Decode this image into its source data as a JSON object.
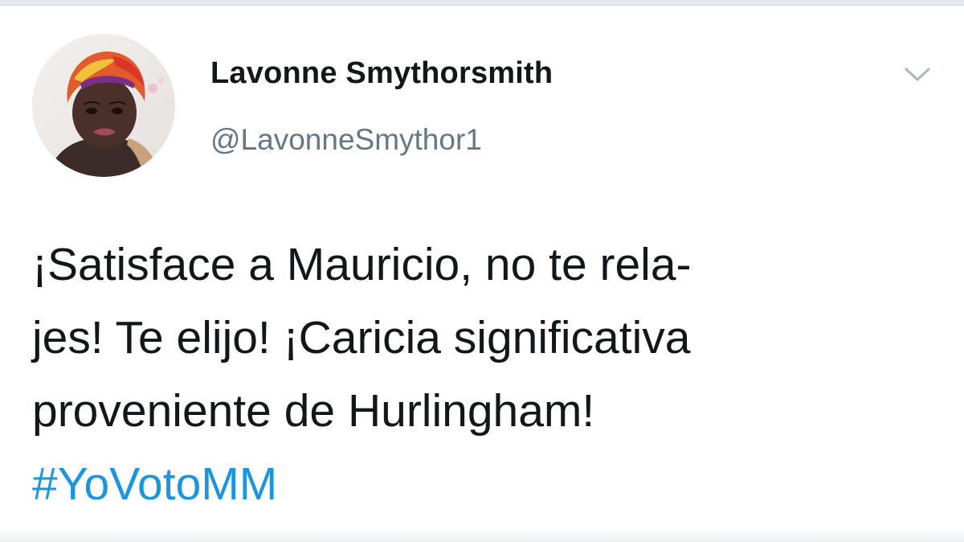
{
  "tweet": {
    "author": {
      "display_name": "Lavonne Smythorsmith",
      "handle": "@LavonneSmythor1"
    },
    "text_lines": [
      "¡Satisface a Mauricio, no te rela-",
      "jes! Te elijo! ¡Caricia significativa",
      "proveniente de Hurlingham!"
    ],
    "hashtag": "#YoVotoMM",
    "icons": {
      "menu": "chevron-down-icon",
      "avatar": "profile-photo"
    }
  },
  "colors": {
    "text": "#14171a",
    "secondary_text": "#657786",
    "link": "#1b95e0",
    "caret": "#aab8c2",
    "background": "#ffffff"
  }
}
